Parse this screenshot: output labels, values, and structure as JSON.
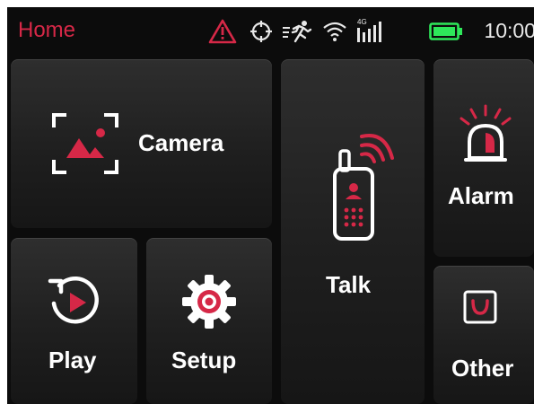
{
  "status_bar": {
    "title": "Home",
    "time": "10:00",
    "icons": [
      "warning-icon",
      "gps-icon",
      "motion-icon",
      "wifi-icon",
      "cellular-4g-icon",
      "battery-icon"
    ],
    "signal_tech": "4G"
  },
  "tiles": {
    "camera": {
      "label": "Camera",
      "icon": "camera-frame-icon"
    },
    "talk": {
      "label": "Talk",
      "icon": "walkie-talkie-icon"
    },
    "alarm": {
      "label": "Alarm",
      "icon": "siren-icon"
    },
    "play": {
      "label": "Play",
      "icon": "replay-icon"
    },
    "setup": {
      "label": "Setup",
      "icon": "gear-icon"
    },
    "other": {
      "label": "Other",
      "icon": "bag-icon"
    }
  },
  "colors": {
    "accent": "#d62847",
    "battery": "#2ee85a",
    "background": "#0c0c0c",
    "tile": "#262626",
    "text": "#ffffff"
  }
}
